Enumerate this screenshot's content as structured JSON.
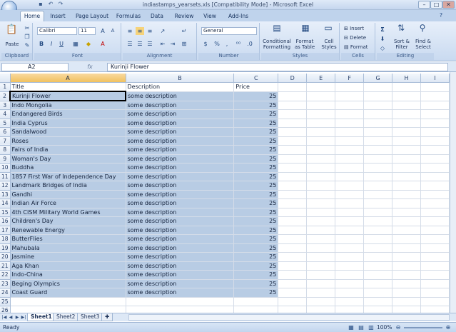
{
  "window": {
    "title": "indiastamps_yearsets.xls  [Compatibility Mode] - Microsoft Excel",
    "controls": [
      "–",
      "□",
      "✕"
    ]
  },
  "ribbon_tabs": [
    "Home",
    "Insert",
    "Page Layout",
    "Formulas",
    "Data",
    "Review",
    "View",
    "Add-Ins"
  ],
  "ribbon": {
    "clipboard": {
      "label": "Clipboard",
      "paste": "Paste"
    },
    "font": {
      "label": "Font",
      "family": "Calibri",
      "size": "11"
    },
    "alignment": {
      "label": "Alignment"
    },
    "number": {
      "label": "Number",
      "format": "General",
      "currency": "$",
      "percent": "%",
      "comma": ","
    },
    "styles": {
      "label": "Styles",
      "conditional": "Conditional",
      "conditional2": "Formatting",
      "format_table": "Format",
      "format_table2": "as Table",
      "cell_styles": "Cell",
      "cell_styles2": "Styles"
    },
    "cells": {
      "label": "Cells",
      "insert": "Insert",
      "delete": "Delete",
      "format": "Format"
    },
    "editing": {
      "label": "Editing",
      "sort": "Sort &",
      "sort2": "Filter",
      "find": "Find &",
      "find2": "Select"
    }
  },
  "formula_bar": {
    "name_box": "A2",
    "fx": "fx",
    "content": "Kurinji Flower"
  },
  "columns": [
    "A",
    "B",
    "C",
    "D",
    "E",
    "F",
    "G",
    "H",
    "I"
  ],
  "header_row": {
    "row": "1",
    "a": "Title",
    "b": "Description",
    "c": "Price"
  },
  "rows": [
    {
      "row": "2",
      "title": "Kurinji Flower",
      "desc": "some description",
      "price": "25"
    },
    {
      "row": "3",
      "title": "Indo Mongolia",
      "desc": "some description",
      "price": "25"
    },
    {
      "row": "4",
      "title": "Endangered Birds",
      "desc": "some description",
      "price": "25"
    },
    {
      "row": "5",
      "title": "India Cyprus",
      "desc": "some description",
      "price": "25"
    },
    {
      "row": "6",
      "title": "Sandalwood",
      "desc": "some description",
      "price": "25"
    },
    {
      "row": "7",
      "title": "Roses",
      "desc": "some description",
      "price": "25"
    },
    {
      "row": "8",
      "title": "Fairs of India",
      "desc": "some description",
      "price": "25"
    },
    {
      "row": "9",
      "title": "Woman's Day",
      "desc": "some description",
      "price": "25"
    },
    {
      "row": "10",
      "title": "Buddha",
      "desc": "some description",
      "price": "25"
    },
    {
      "row": "11",
      "title": "1857 First War of Independence Day",
      "desc": "some description",
      "price": "25"
    },
    {
      "row": "12",
      "title": "Landmark Bridges of India",
      "desc": "some description",
      "price": "25"
    },
    {
      "row": "13",
      "title": "Gandhi",
      "desc": "some description",
      "price": "25"
    },
    {
      "row": "14",
      "title": "Indian Air Force",
      "desc": "some description",
      "price": "25"
    },
    {
      "row": "15",
      "title": "4th CISM Military World Games",
      "desc": "some description",
      "price": "25"
    },
    {
      "row": "16",
      "title": "Children's Day",
      "desc": "some description",
      "price": "25"
    },
    {
      "row": "17",
      "title": "Renewable Energy",
      "desc": "some description",
      "price": "25"
    },
    {
      "row": "18",
      "title": "ButterFlies",
      "desc": "some description",
      "price": "25"
    },
    {
      "row": "19",
      "title": "Mahubala",
      "desc": "some description",
      "price": "25"
    },
    {
      "row": "20",
      "title": "Jasmine",
      "desc": "some description",
      "price": "25"
    },
    {
      "row": "21",
      "title": "Aga Khan",
      "desc": "some description",
      "price": "25"
    },
    {
      "row": "22",
      "title": "Indo-China",
      "desc": "some description",
      "price": "25"
    },
    {
      "row": "23",
      "title": "Beging Olympics",
      "desc": "some description",
      "price": "25"
    },
    {
      "row": "24",
      "title": "Coast Guard",
      "desc": "some description",
      "price": "25"
    }
  ],
  "empty_rows": [
    "25",
    "26"
  ],
  "sheets": [
    "Sheet1",
    "Sheet2",
    "Sheet3"
  ],
  "status": {
    "text": "Ready",
    "zoom": "100%"
  }
}
